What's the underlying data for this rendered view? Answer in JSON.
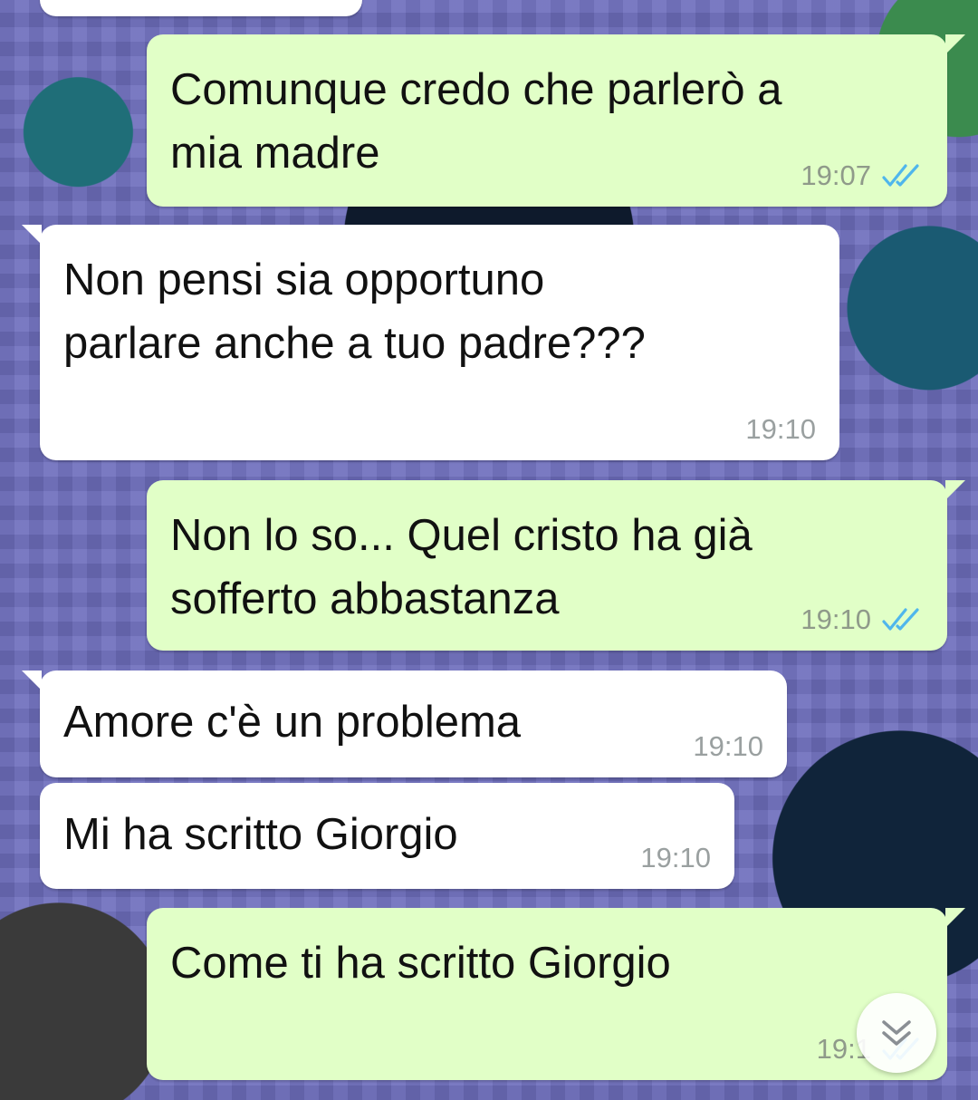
{
  "chat": {
    "messages": [
      {
        "direction": "outgoing",
        "text": "Comunque credo che parlerò a\nmia madre",
        "time": "19:07",
        "status": "read"
      },
      {
        "direction": "incoming",
        "text": "Non pensi sia opportuno\nparlare anche a tuo padre???",
        "time": "19:10"
      },
      {
        "direction": "outgoing",
        "text": "Non lo so... Quel cristo ha già\nsofferto abbastanza",
        "time": "19:10",
        "status": "read"
      },
      {
        "direction": "incoming",
        "text": "Amore c'è un problema",
        "time": "19:10"
      },
      {
        "direction": "incoming",
        "text": "Mi ha scritto Giorgio",
        "time": "19:10"
      },
      {
        "direction": "outgoing",
        "text": "Come ti ha scritto Giorgio",
        "time": "19:1",
        "status": "read"
      }
    ],
    "scroll_button_icon": "double-chevron-down-icon",
    "colors": {
      "outgoing_bubble": "#e1ffc7",
      "incoming_bubble": "#ffffff",
      "read_ticks": "#4fb6ec"
    }
  }
}
